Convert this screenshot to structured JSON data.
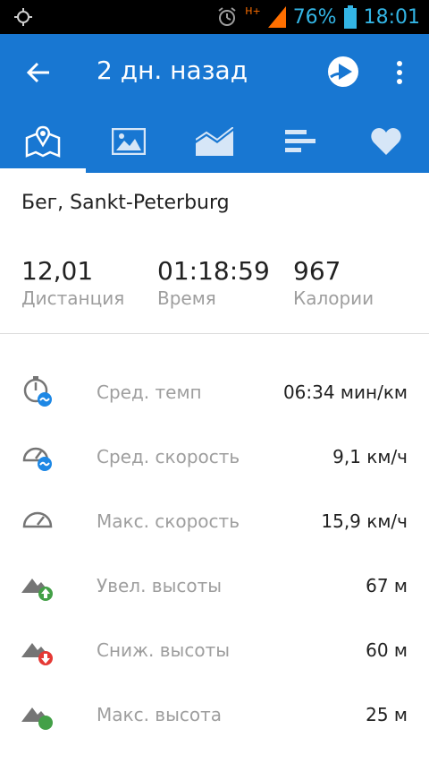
{
  "status_bar": {
    "network": "H+",
    "battery": "76%",
    "time": "18:01"
  },
  "app_bar": {
    "title": "2 дн. назад"
  },
  "tabs": [
    {
      "icon": "map-icon",
      "active": true
    },
    {
      "icon": "image-icon",
      "active": false
    },
    {
      "icon": "chart-icon",
      "active": false
    },
    {
      "icon": "bars-icon",
      "active": false
    },
    {
      "icon": "heart-icon",
      "active": false
    }
  ],
  "activity": {
    "title": "Бег, Sankt-Peterburg"
  },
  "summary": {
    "distance": {
      "value": "12,01",
      "label": "Дистанция"
    },
    "time": {
      "value": "01:18:59",
      "label": "Время"
    },
    "calories": {
      "value": "967",
      "label": "Калории"
    }
  },
  "metrics": [
    {
      "label": "Сред. темп",
      "value": "06:34 мин/км",
      "icon": "avg-pace-icon"
    },
    {
      "label": "Сред. скорость",
      "value": "9,1 км/ч",
      "icon": "avg-speed-icon"
    },
    {
      "label": "Макс. скорость",
      "value": "15,9 км/ч",
      "icon": "max-speed-icon"
    },
    {
      "label": "Увел. высоты",
      "value": "67 м",
      "icon": "elevation-gain-icon"
    },
    {
      "label": "Сниж. высоты",
      "value": "60 м",
      "icon": "elevation-loss-icon"
    },
    {
      "label": "Макс. высота",
      "value": "25 м",
      "icon": "max-elevation-icon"
    }
  ],
  "colors": {
    "accent": "#1877d2",
    "status_blue": "#33b5e5",
    "green": "#43a047",
    "red": "#e53935"
  }
}
